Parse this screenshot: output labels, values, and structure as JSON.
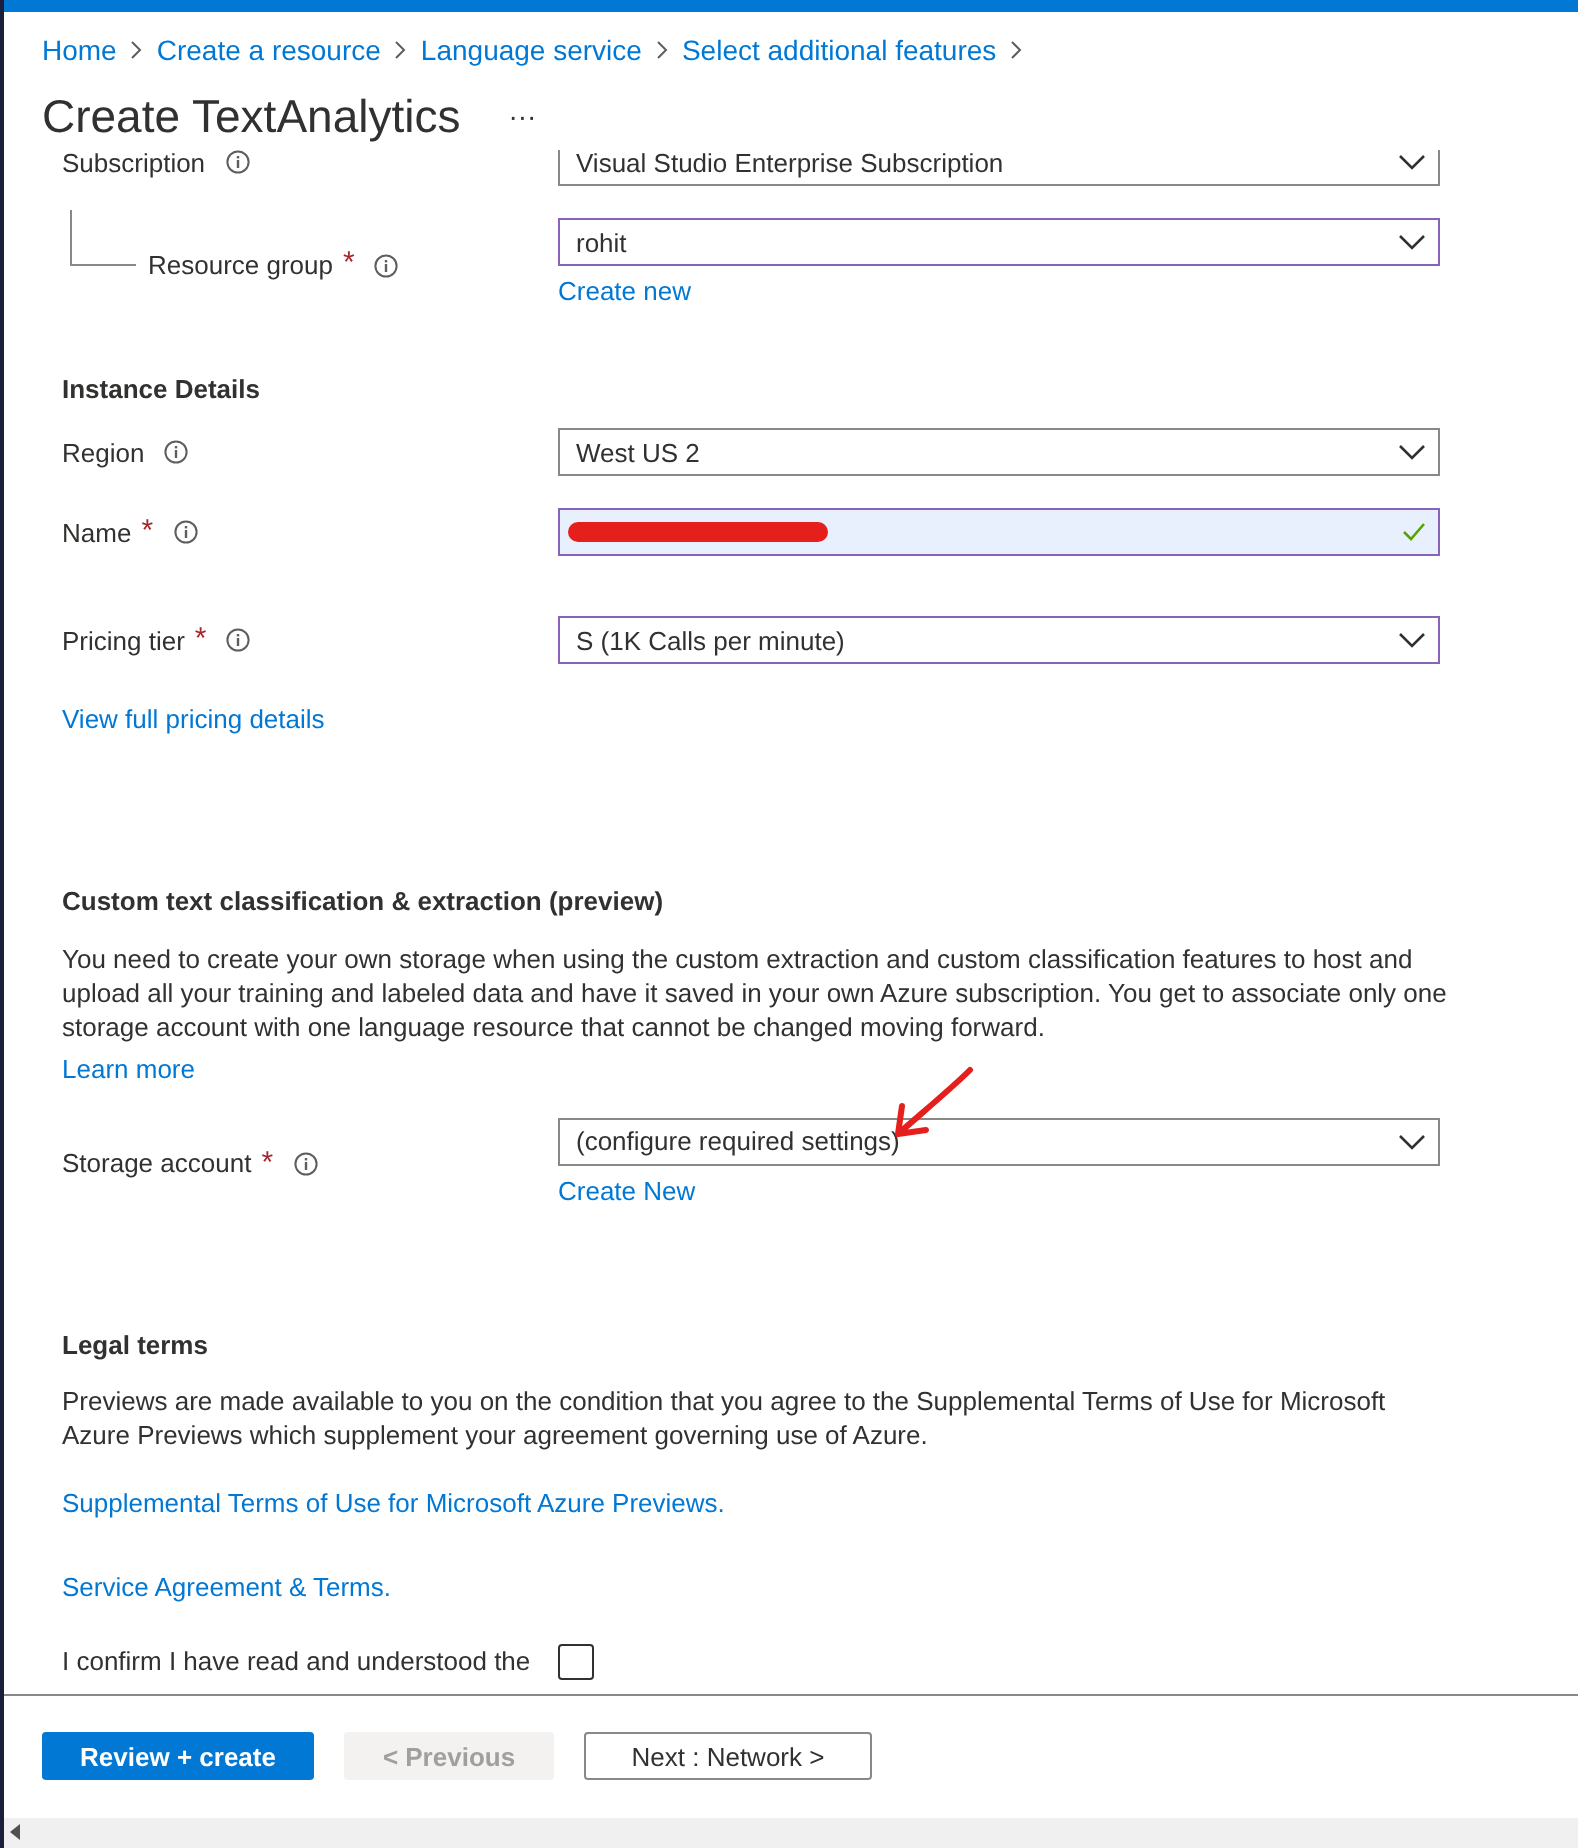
{
  "breadcrumb": [
    {
      "label": "Home"
    },
    {
      "label": "Create a resource"
    },
    {
      "label": "Language service"
    },
    {
      "label": "Select additional features"
    }
  ],
  "title": "Create TextAnalytics",
  "more": "···",
  "items": [
    {
      "kind": "field",
      "label": "Subscription",
      "value": "Visual Studio Enterprise Subscription",
      "highlighted": false,
      "children": [
        {
          "kind": "field",
          "label": "Resource group",
          "required_mark": "*",
          "value": "rohit",
          "highlighted": true,
          "link": "Create new"
        }
      ]
    },
    {
      "kind": "heading",
      "text": "Instance Details"
    },
    {
      "kind": "field",
      "label": "Region",
      "value": "West US 2",
      "highlighted": false
    },
    {
      "kind": "textfield",
      "label": "Name",
      "required_mark": "*",
      "redacted": true,
      "valid": true,
      "highlighted": true
    },
    {
      "kind": "field",
      "label": "Pricing tier",
      "required_mark": "*",
      "value": "S (1K Calls per minute)",
      "highlighted": true
    },
    {
      "kind": "link",
      "text": "View full pricing details"
    },
    {
      "kind": "heading",
      "text": "Custom text classification & extraction (preview)"
    },
    {
      "kind": "paragraph",
      "text": "You need to create your own storage when using the custom extraction and custom classification features to host and upload all your training and labeled data and have it saved in your own Azure subscription. You get to associate only one storage account with one language resource that cannot be changed moving forward."
    },
    {
      "kind": "link",
      "text": "Learn more"
    },
    {
      "kind": "arrow"
    },
    {
      "kind": "field",
      "label": "Storage account",
      "required_mark": "*",
      "value": "(configure required settings)",
      "highlighted": false,
      "link": "Create New"
    },
    {
      "kind": "heading",
      "text": "Legal terms"
    },
    {
      "kind": "paragraph",
      "text": "Previews are made available to you on the condition that you agree to the Supplemental Terms of Use for Microsoft Azure Previews which supplement your agreement governing use of Azure."
    },
    {
      "kind": "link",
      "text": "Supplemental Terms of Use for Microsoft Azure Previews."
    },
    {
      "kind": "link",
      "text": "Service Agreement & Terms."
    },
    {
      "kind": "checkbox",
      "text": "I confirm I have read and understood the",
      "checked": false
    }
  ],
  "buttons": [
    {
      "label": "Review + create",
      "kind": "primary",
      "disabled": false
    },
    {
      "label": "< Previous",
      "kind": "secondary",
      "disabled": true
    },
    {
      "label": "Next : Network >",
      "kind": "secondary",
      "disabled": false
    }
  ]
}
